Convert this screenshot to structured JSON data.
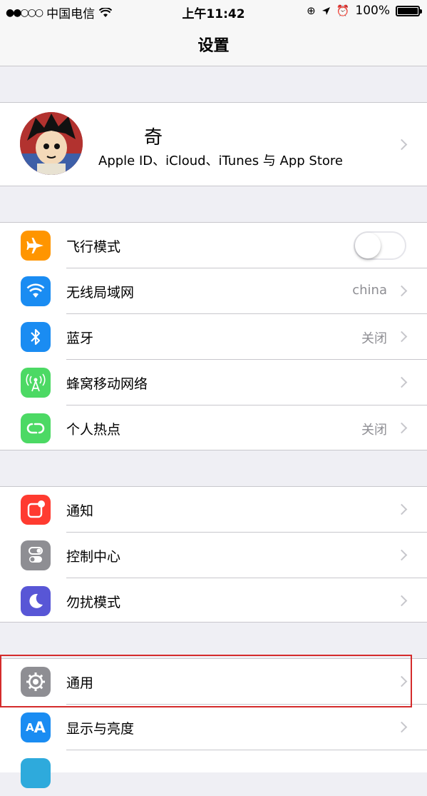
{
  "status_bar": {
    "carrier": "中国电信",
    "time": "上午11:42",
    "battery": "100%",
    "battery_level": 1.0
  },
  "nav": {
    "title": "设置"
  },
  "profile": {
    "name": "奇",
    "subtitle": "Apple ID、iCloud、iTunes 与 App Store",
    "avatar_icon": "cartoon-avatar"
  },
  "groups": {
    "connectivity": [
      {
        "label": "飞行模式",
        "value": "",
        "icon": "airplane-icon",
        "color": "#ff9500",
        "toggle": false
      },
      {
        "label": "无线局域网",
        "value": "china",
        "icon": "wifi-icon",
        "color": "#1a8cf2"
      },
      {
        "label": "蓝牙",
        "value": "关闭",
        "icon": "bluetooth-icon",
        "color": "#1a8cf2"
      },
      {
        "label": "蜂窝移动网络",
        "value": "",
        "icon": "cellular-antenna-icon",
        "color": "#4cd964"
      },
      {
        "label": "个人热点",
        "value": "关闭",
        "icon": "hotspot-icon",
        "color": "#4cd964"
      }
    ],
    "notifications": [
      {
        "label": "通知",
        "icon": "notifications-icon",
        "color": "#ff3b30"
      },
      {
        "label": "控制中心",
        "icon": "control-center-icon",
        "color": "#8e8e93"
      },
      {
        "label": "勿扰模式",
        "icon": "moon-icon",
        "color": "#5856d6"
      }
    ],
    "general": [
      {
        "label": "通用",
        "icon": "gear-icon",
        "color": "#8e8e93"
      },
      {
        "label": "显示与亮度",
        "icon": "text-size-icon",
        "color": "#1a8cf2"
      }
    ]
  },
  "highlight_color": "#d42b2b"
}
